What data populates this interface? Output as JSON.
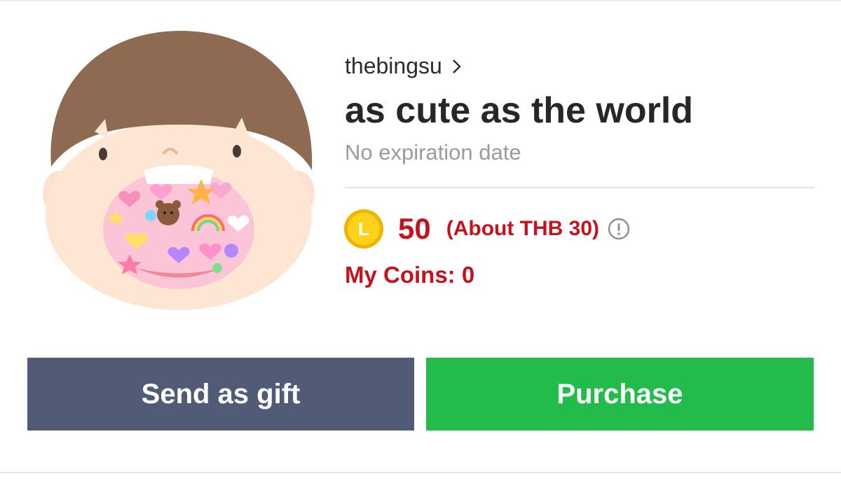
{
  "product": {
    "creator": "thebingsu",
    "title": "as cute as the world",
    "validity": "No expiration date",
    "image_icon": "sticker-thumbnail",
    "logo_text": ""
  },
  "price": {
    "coin_symbol": "L",
    "amount": "50",
    "approx": "(About THB 30)",
    "info_icon": "info-circle-icon"
  },
  "wallet": {
    "my_coins": "My Coins: 0"
  },
  "actions": {
    "gift_label": "Send as gift",
    "purchase_label": "Purchase"
  },
  "colors": {
    "price_red": "#c7121d",
    "gift_button": "#525b75",
    "purchase_button": "#21bc4b",
    "coin_gold": "#f5c518"
  }
}
